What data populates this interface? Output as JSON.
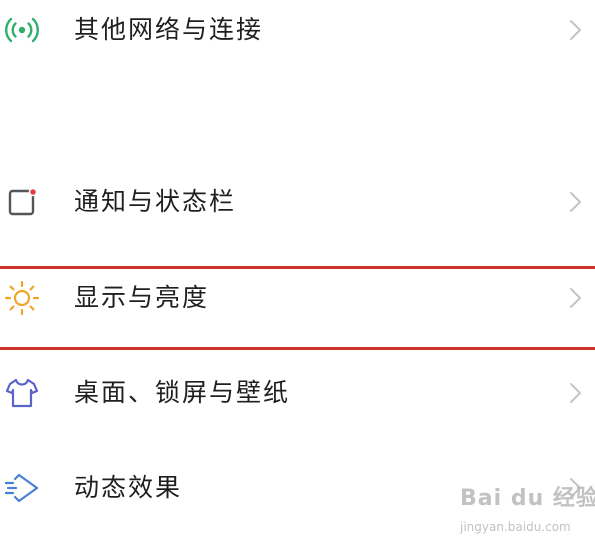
{
  "settings": {
    "items": [
      {
        "label": "其他网络与连接",
        "icon": "wireless-signal-icon",
        "icon_color": "#2fb06a"
      },
      {
        "label": "通知与状态栏",
        "icon": "notification-square-icon",
        "icon_color": "#555555"
      },
      {
        "label": "显示与亮度",
        "icon": "sun-brightness-icon",
        "icon_color": "#f0a52d",
        "highlighted": true
      },
      {
        "label": "桌面、锁屏与壁纸",
        "icon": "shirt-icon",
        "icon_color": "#5a63c8"
      },
      {
        "label": "动态效果",
        "icon": "motion-effects-icon",
        "icon_color": "#4a7fd6"
      }
    ]
  },
  "highlight_color": "#d0312d",
  "watermark": {
    "brand": "Bai du 经验",
    "url": "jingyan.baidu.com"
  }
}
